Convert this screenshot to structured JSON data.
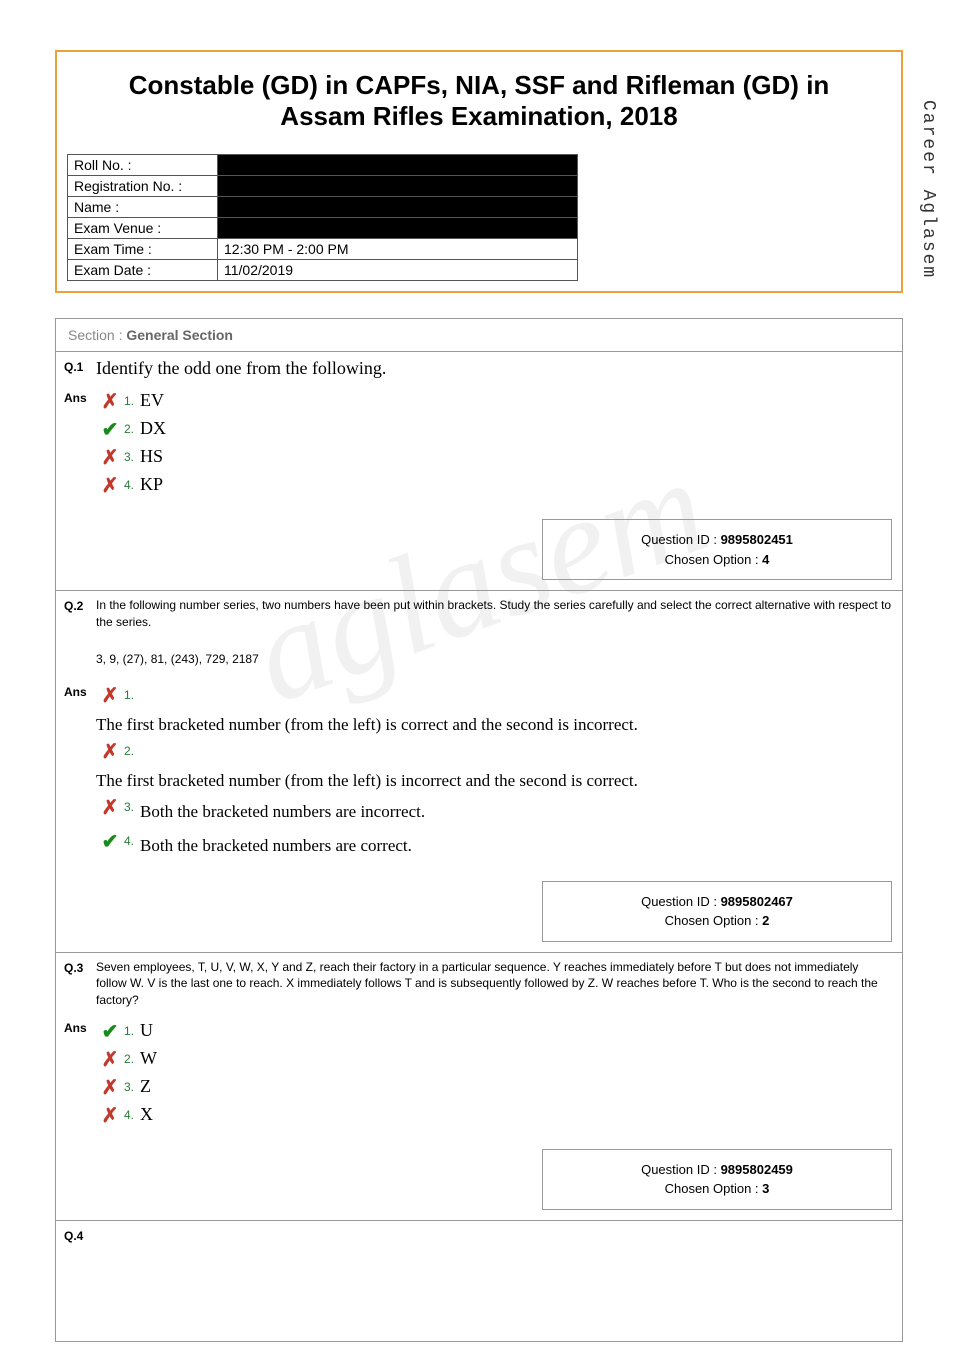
{
  "sideWatermark": "Career Aglasem",
  "centerWatermark": "aglasem",
  "title": "Constable (GD) in CAPFs, NIA, SSF and Rifleman (GD) in Assam Rifles Examination, 2018",
  "info": {
    "rollNoLabel": "Roll No. :",
    "regNoLabel": "Registration No. :",
    "nameLabel": "Name :",
    "venueLabel": "Exam Venue :",
    "timeLabel": "Exam Time :",
    "timeValue": "12:30 PM - 2:00 PM",
    "dateLabel": "Exam Date :",
    "dateValue": "11/02/2019"
  },
  "section": {
    "prefix": "Section : ",
    "name": "General Section"
  },
  "q1": {
    "num": "Q.1",
    "text": "Identify the odd one from the following.",
    "ansLabel": "Ans",
    "options": [
      {
        "num": "1.",
        "text": "EV",
        "mark": "cross"
      },
      {
        "num": "2.",
        "text": "DX",
        "mark": "check"
      },
      {
        "num": "3.",
        "text": "HS",
        "mark": "cross"
      },
      {
        "num": "4.",
        "text": "KP",
        "mark": "cross"
      }
    ],
    "qidLabel": "Question ID : ",
    "qid": "9895802451",
    "chosenLabel": "Chosen Option : ",
    "chosen": "4"
  },
  "q2": {
    "num": "Q.2",
    "text": "In the following number series, two numbers have been put within brackets. Study the series carefully and select the correct alternative with respect to the series.",
    "series": "3, 9, (27), 81, (243), 729, 2187",
    "ansLabel": "Ans",
    "options": [
      {
        "num": "1.",
        "text": "The first bracketed number (from the left) is correct and the second is incorrect.",
        "mark": "cross"
      },
      {
        "num": "2.",
        "text": "The first bracketed number (from the left) is incorrect and the second is correct.",
        "mark": "cross"
      },
      {
        "num": "3.",
        "text": "Both the bracketed numbers are incorrect.",
        "mark": "cross"
      },
      {
        "num": "4.",
        "text": "Both the bracketed numbers are correct.",
        "mark": "check"
      }
    ],
    "qidLabel": "Question ID : ",
    "qid": "9895802467",
    "chosenLabel": "Chosen Option : ",
    "chosen": "2"
  },
  "q3": {
    "num": "Q.3",
    "text": "Seven employees, T, U, V, W, X, Y and Z, reach their factory in a particular sequence. Y reaches immediately before T but does not immediately follow W. V is the last one to reach. X immediately follows T and is subsequently followed by Z. W reaches before T. Who is the second to reach the factory?",
    "ansLabel": "Ans",
    "options": [
      {
        "num": "1.",
        "text": "U",
        "mark": "check"
      },
      {
        "num": "2.",
        "text": "W",
        "mark": "cross"
      },
      {
        "num": "3.",
        "text": "Z",
        "mark": "cross"
      },
      {
        "num": "4.",
        "text": "X",
        "mark": "cross"
      }
    ],
    "qidLabel": "Question ID : ",
    "qid": "9895802459",
    "chosenLabel": "Chosen Option : ",
    "chosen": "3"
  },
  "q4": {
    "num": "Q.4"
  }
}
